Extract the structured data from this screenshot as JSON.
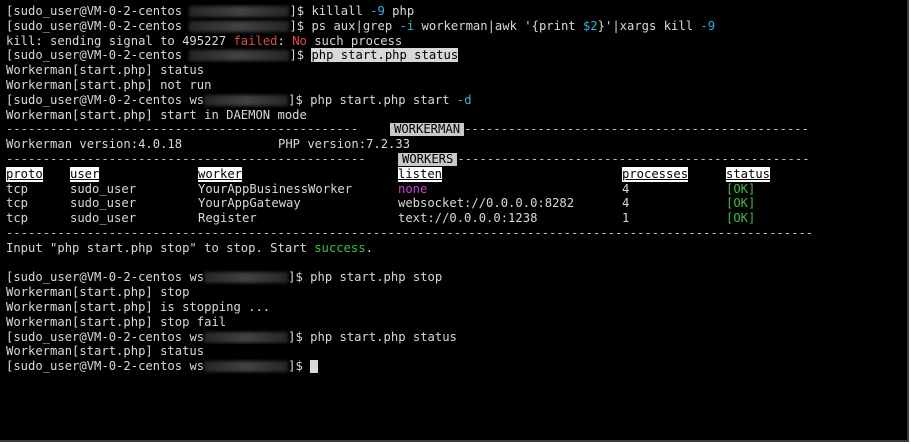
{
  "prompt": {
    "user_host": "[sudo_user@VM-0-2-centos ",
    "dir_short": "ws",
    "end": "]$ "
  },
  "lines": {
    "l1_cmd": "killall ",
    "l1_flag": "-9",
    "l1_arg": " php",
    "l2_cmd": "ps aux|grep ",
    "l2_flag": "-i",
    "l2_mid": " workerman|awk '{print ",
    "l2_var": "$2",
    "l2_end": "}'|xargs kill ",
    "l2_flag2": "-9",
    "l3_a": "kill: sending signal to 495227 ",
    "l3_failed": "failed",
    "l3_colon": ": ",
    "l3_no": "No",
    "l3_rest": " such process",
    "l4_cmd": "php start.php status",
    "l5": "Workerman[start.php] status",
    "l6": "Workerman[start.php] not run",
    "l7_cmd": "php start.php start ",
    "l7_flag": "-d",
    "l8": "Workerman[start.php] start in DAEMON mode",
    "l9_label": "WORKERMAN",
    "l10_a": "Workerman version:4.0.18",
    "l10_b": "PHP version:7.2.33",
    "l11_label": "WORKERS",
    "l17": "Input \"php start.php stop\" to stop. Start ",
    "l17_success": "success",
    "l17_end": ".",
    "l19_cmd": "php start.php stop",
    "l20": "Workerman[start.php] stop",
    "l21": "Workerman[start.php] is stopping ...",
    "l22": "Workerman[start.php] stop fail",
    "l23_cmd": "php start.php status",
    "l24": "Workerman[start.php] status"
  },
  "workers_table": {
    "headers": [
      "proto",
      "user",
      "worker",
      "listen",
      "processes",
      "status"
    ],
    "rows": [
      [
        "tcp",
        "sudo_user",
        "YourAppBusinessWorker",
        "none",
        "4",
        "[OK]"
      ],
      [
        "tcp",
        "sudo_user",
        "YourAppGateway",
        "websocket://0.0.0.0:8282",
        "4",
        "[OK]"
      ],
      [
        "tcp",
        "sudo_user",
        "Register",
        "text://0.0.0.0:1238",
        "1",
        "[OK]"
      ]
    ]
  },
  "colors": {
    "background": "#000000",
    "foreground": "#d8d8d8",
    "flag_cyan": "#3ab0d9",
    "error_red": "#e04b4b",
    "none_magenta": "#d040d0",
    "ok_green": "#3fbf3f"
  }
}
